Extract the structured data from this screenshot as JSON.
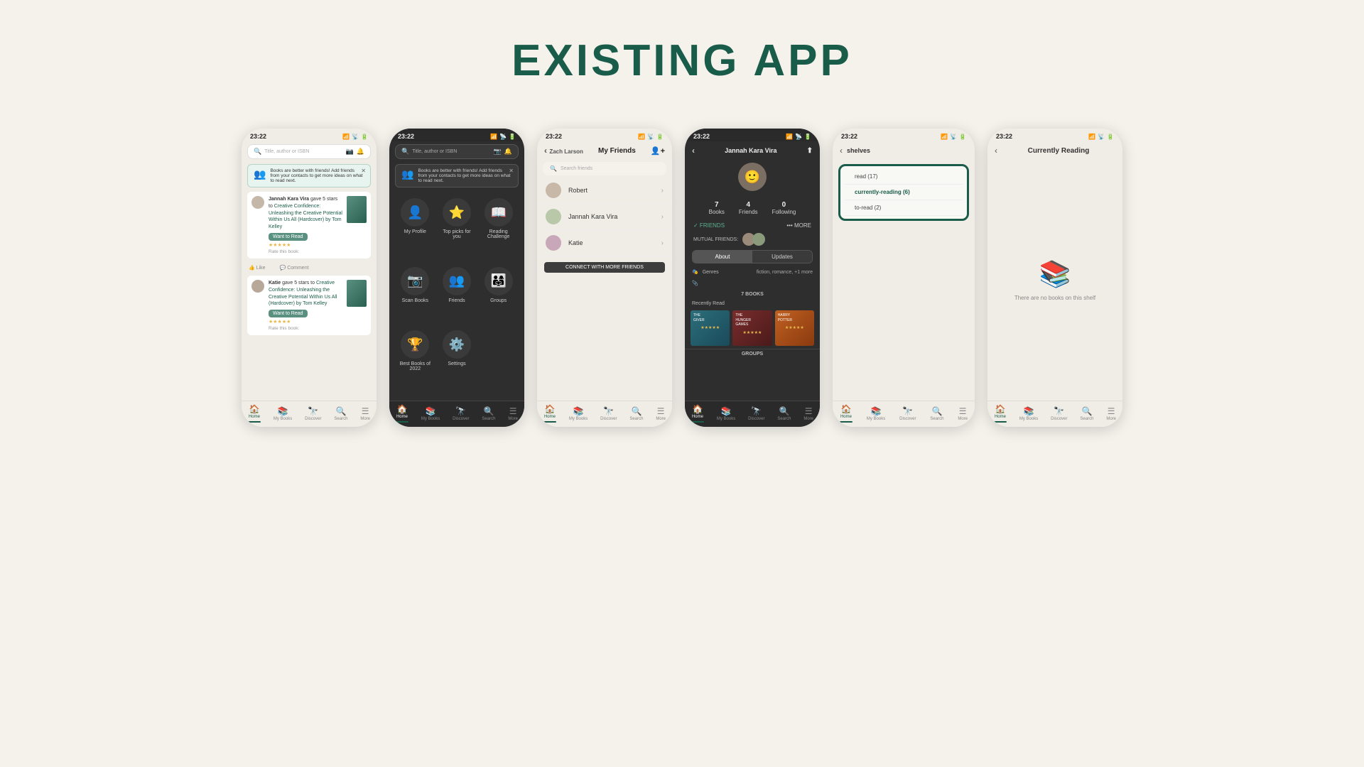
{
  "page": {
    "title": "EXISTING APP",
    "background": "#f5f2ec"
  },
  "phones": [
    {
      "id": "phone1",
      "theme": "light",
      "time": "23:22",
      "screen": "home_feed"
    },
    {
      "id": "phone2",
      "theme": "dark",
      "time": "23:22",
      "screen": "menu"
    },
    {
      "id": "phone3",
      "theme": "light",
      "time": "23:22",
      "screen": "friends"
    },
    {
      "id": "phone4",
      "theme": "dark",
      "time": "23:22",
      "screen": "profile"
    },
    {
      "id": "phone5",
      "theme": "light",
      "time": "23:22",
      "screen": "shelves"
    },
    {
      "id": "phone6",
      "theme": "light",
      "time": "23:22",
      "screen": "currently_reading"
    }
  ],
  "ui": {
    "search_placeholder": "Title, author or ISBN",
    "notif_text": "Books are better with friends! Add friends from your contacts to get more ideas on what to read next.",
    "feed": {
      "user1": "Jannah Kara Vira",
      "action1": "gave 5 stars to",
      "book1": "Creative Confidence: Unleashing the Creative Potential Within Us All (Hardcover) by Tom Kelley",
      "user2": "Katie",
      "action2": "gave 5 stars to",
      "book2": "Creative Confidence: Unleashing the Creative Potential Within Us All (Hardcover) by Tom Kelley",
      "want_to_read": "Want to Read",
      "rate_text": "Rate this book:"
    },
    "actions": {
      "like": "Like",
      "comment": "Comment"
    },
    "menu_items": [
      {
        "label": "My Profile",
        "icon": "👤"
      },
      {
        "label": "Top picks for you",
        "icon": "⭐"
      },
      {
        "label": "Reading Challenge",
        "icon": "📖"
      },
      {
        "label": "Scan Books",
        "icon": "📷"
      },
      {
        "label": "Friends",
        "icon": "👥"
      },
      {
        "label": "Groups",
        "icon": "👨‍👩‍👧"
      },
      {
        "label": "Best Books of 2022",
        "icon": "🏆"
      },
      {
        "label": "Settings",
        "icon": "⚙️"
      }
    ],
    "friends": {
      "header": "My Friends",
      "user": "Zach Larson",
      "list": [
        "Robert",
        "Jannah Kara Vira",
        "Katie"
      ],
      "connect_btn": "CONNECT WITH MORE FRIENDS"
    },
    "profile": {
      "name": "Jannah Kara Vira",
      "books": "7",
      "friends": "4",
      "following": "0",
      "books_label": "Books",
      "friends_label": "Friends",
      "following_label": "Following",
      "friends_status": "✓ FRIENDS",
      "more": "••• MORE",
      "mutual_label": "MUTUAL FRIENDS:",
      "tab_about": "About",
      "tab_updates": "Updates",
      "genres_label": "Genres",
      "genres_value": "fiction, romance, +1 more",
      "books_count": "7 BOOKS",
      "recently_read": "Recently Read",
      "groups": "GROUPS"
    },
    "shelves": {
      "header": "< ",
      "read": "read (17)",
      "currently_reading": "currently-reading (6)",
      "to_read": "to-read (2)"
    },
    "currently_reading": {
      "header": "Currently Reading",
      "empty_text": "There are no books on this shelf"
    },
    "bottom_nav": [
      "Home",
      "My Books",
      "Discover",
      "Search",
      "More"
    ]
  }
}
